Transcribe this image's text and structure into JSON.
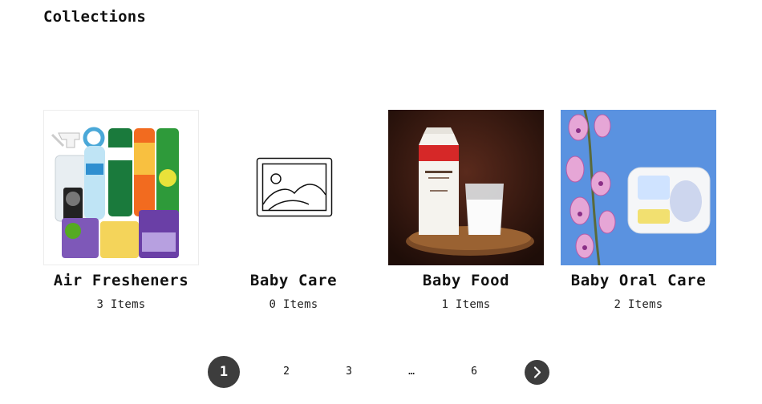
{
  "page": {
    "title": "Collections"
  },
  "collections": [
    {
      "name": "Air Fresheners",
      "count": "3 Items",
      "image": "air-fresheners-product-photo"
    },
    {
      "name": "Baby Care",
      "count": "0 Items",
      "image": "image-placeholder-icon"
    },
    {
      "name": "Baby Food",
      "count": "1 Items",
      "image": "milk-carton-and-glass-photo"
    },
    {
      "name": "Baby Oral Care",
      "count": "2 Items",
      "image": "wipes-pack-and-orchid-photo"
    }
  ],
  "pagination": {
    "pages": [
      "1",
      "2",
      "3",
      "…",
      "6"
    ],
    "current": "1",
    "next_icon": "chevron-right-icon"
  },
  "colors": {
    "active_page_bg": "#3d3d3d",
    "text": "#111111",
    "background": "#ffffff"
  }
}
